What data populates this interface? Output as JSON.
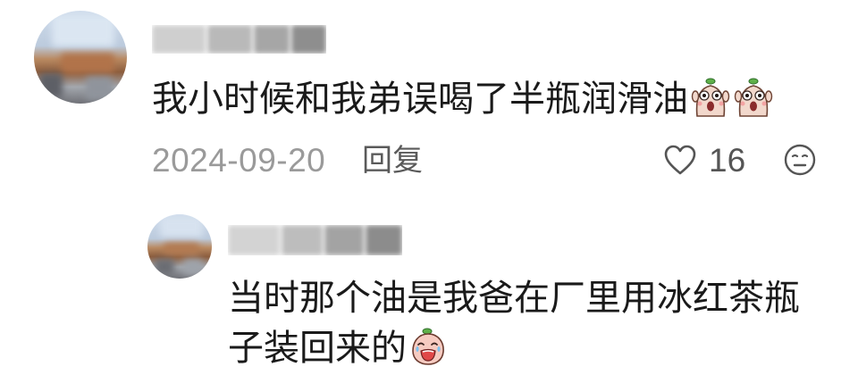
{
  "comment": {
    "text": "我小时候和我弟误喝了半瓶润滑油",
    "stickers": [
      "shocked-sticker-icon",
      "shocked-sticker-icon"
    ],
    "date": "2024-09-20",
    "reply_label": "回复",
    "likes": "16",
    "like_icon": "heart-icon",
    "dislike_icon": "dislike-face-icon"
  },
  "reply": {
    "text": "当时那个油是我爸在厂里用冰红茶瓶子装回来的",
    "sticker": "scream-sticker-icon"
  },
  "colors": {
    "background": "#ffffff",
    "text": "#1a1a1a",
    "date": "#9a9a9a",
    "action": "#555555"
  }
}
